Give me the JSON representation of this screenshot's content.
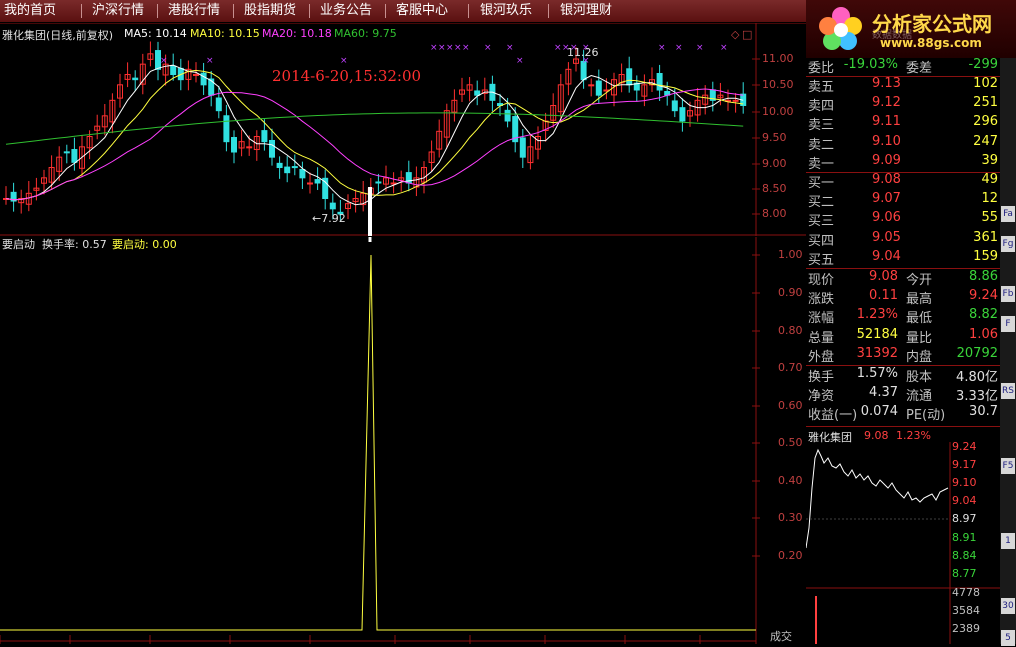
{
  "menu": [
    "我的首页",
    "沪深行情",
    "港股行情",
    "股指期货",
    "业务公告",
    "客服中心",
    "银河玖乐",
    "银河理财"
  ],
  "logo": {
    "title": "分析家公式网",
    "url": "www.88gs.com",
    "back_text": "数据数据"
  },
  "kline": {
    "title": "雅化集团(日线,前复权)",
    "ma5_label": "MA5: 10.14",
    "ma10_label": "MA10: 10.15",
    "ma20_label": "MA20: 10.18",
    "ma60_label": "MA60: 9.75",
    "timestamp": "2014-6-20,15:32:00",
    "high_mark": "11.26",
    "low_mark": "←7.92",
    "y_ticks": [
      "11.00",
      "10.50",
      "10.00",
      "9.50",
      "9.00",
      "8.50",
      "8.00"
    ],
    "colors": {
      "ma5": "#ffffff",
      "ma10": "#ffff40",
      "ma20": "#ff40ff",
      "ma60": "#30c030",
      "up": "#ff3030",
      "down": "#30e0e0"
    }
  },
  "indicator": {
    "name": "要启动",
    "turnover_label": "换手率: 0.57",
    "value_label": "要启动: 0.00",
    "y_ticks": [
      "1.00",
      "0.90",
      "0.80",
      "0.70",
      "0.60",
      "0.50",
      "0.40",
      "0.30",
      "0.20"
    ]
  },
  "quote": {
    "webi": {
      "label": "委比",
      "value": "-19.03%",
      "label2": "委差",
      "value2": "-299"
    },
    "sell": [
      {
        "label": "卖五",
        "price": "9.13",
        "vol": "102"
      },
      {
        "label": "卖四",
        "price": "9.12",
        "vol": "251"
      },
      {
        "label": "卖三",
        "price": "9.11",
        "vol": "296"
      },
      {
        "label": "卖二",
        "price": "9.10",
        "vol": "247"
      },
      {
        "label": "卖一",
        "price": "9.09",
        "vol": "39"
      }
    ],
    "buy": [
      {
        "label": "买一",
        "price": "9.08",
        "vol": "49"
      },
      {
        "label": "买二",
        "price": "9.07",
        "vol": "12"
      },
      {
        "label": "买三",
        "price": "9.06",
        "vol": "55"
      },
      {
        "label": "买四",
        "price": "9.05",
        "vol": "361"
      },
      {
        "label": "买五",
        "price": "9.04",
        "vol": "159"
      }
    ],
    "stats": [
      {
        "l1": "现价",
        "v1": "9.08",
        "c1": "red",
        "l2": "今开",
        "v2": "8.86",
        "c2": "green"
      },
      {
        "l1": "涨跌",
        "v1": "0.11",
        "c1": "red",
        "l2": "最高",
        "v2": "9.24",
        "c2": "red"
      },
      {
        "l1": "涨幅",
        "v1": "1.23%",
        "c1": "red",
        "l2": "最低",
        "v2": "8.82",
        "c2": "green"
      },
      {
        "l1": "总量",
        "v1": "52184",
        "c1": "yellow",
        "l2": "量比",
        "v2": "1.06",
        "c2": "red"
      },
      {
        "l1": "外盘",
        "v1": "31392",
        "c1": "red",
        "l2": "内盘",
        "v2": "20792",
        "c2": "green"
      }
    ],
    "stats2": [
      {
        "l1": "换手",
        "v1": "1.57%",
        "l2": "股本",
        "v2": "4.80亿"
      },
      {
        "l1": "净资",
        "v1": "4.37",
        "l2": "流通",
        "v2": "3.33亿"
      },
      {
        "l1": "收益(一)",
        "v1": "0.074",
        "l2": "PE(动)",
        "v2": "30.7"
      }
    ]
  },
  "minichart": {
    "name": "雅化集团",
    "price": "9.08",
    "pct": "1.23%",
    "y_ticks": [
      "9.24",
      "9.17",
      "9.10",
      "9.04",
      "8.97",
      "8.91",
      "8.84",
      "8.77"
    ],
    "vol_ticks": [
      "4778",
      "3584",
      "2389"
    ],
    "bottom_label": "成交"
  },
  "right_strip": [
    "Fa",
    "Fg",
    "Fb",
    "F",
    "RS",
    "F5",
    "1",
    "30",
    "5"
  ]
}
